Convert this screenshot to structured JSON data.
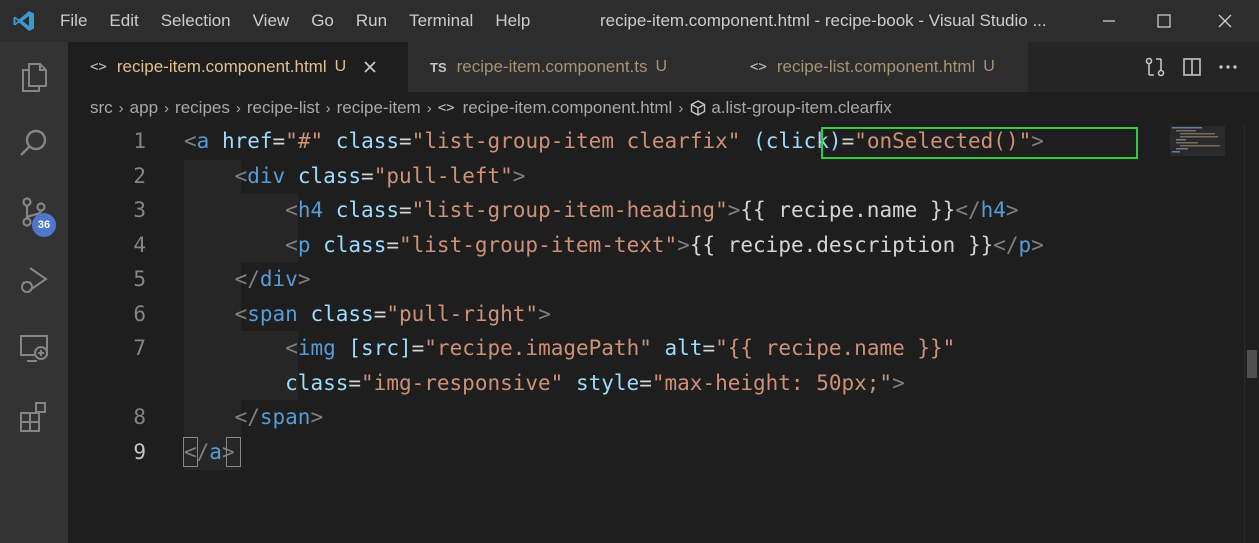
{
  "titlebar": {
    "menu": [
      "File",
      "Edit",
      "Selection",
      "View",
      "Go",
      "Run",
      "Terminal",
      "Help"
    ],
    "title": "recipe-item.component.html - recipe-book - Visual Studio ...",
    "icons": [
      "vscode-logo",
      "minimize-icon",
      "maximize-icon",
      "close-icon"
    ]
  },
  "activitybar": {
    "items": [
      "explorer-icon",
      "search-icon",
      "source-control-icon",
      "run-debug-icon",
      "remote-explorer-icon",
      "extensions-icon"
    ],
    "scm_badge": "36"
  },
  "tabs": [
    {
      "icon": "<>",
      "label": "recipe-item.component.html",
      "flag": "U",
      "active": true
    },
    {
      "icon": "TS",
      "label": "recipe-item.component.ts",
      "flag": "U",
      "active": false
    },
    {
      "icon": "<>",
      "label": "recipe-list.component.html",
      "flag": "U",
      "active": false
    }
  ],
  "editor_actions": [
    "compare-changes-icon",
    "split-editor-icon",
    "more-actions-icon"
  ],
  "breadcrumb": {
    "items": [
      "src",
      "app",
      "recipes",
      "recipe-list",
      "recipe-item",
      "recipe-item.component.html",
      "a.list-group-item.clearfix"
    ]
  },
  "editor": {
    "line_numbers": [
      "1",
      "2",
      "3",
      "4",
      "5",
      "6",
      "7",
      "",
      "8",
      "9"
    ],
    "current_line": "9",
    "highlighted_text": "(click)=\"onSelected()\""
  },
  "colors": {
    "tag": "#569cd6",
    "attribute": "#9cdcfe",
    "string": "#ce9178",
    "text": "#d4d4d4",
    "highlight_border": "#2ecc40",
    "modified_tab": "#e2c08d"
  }
}
